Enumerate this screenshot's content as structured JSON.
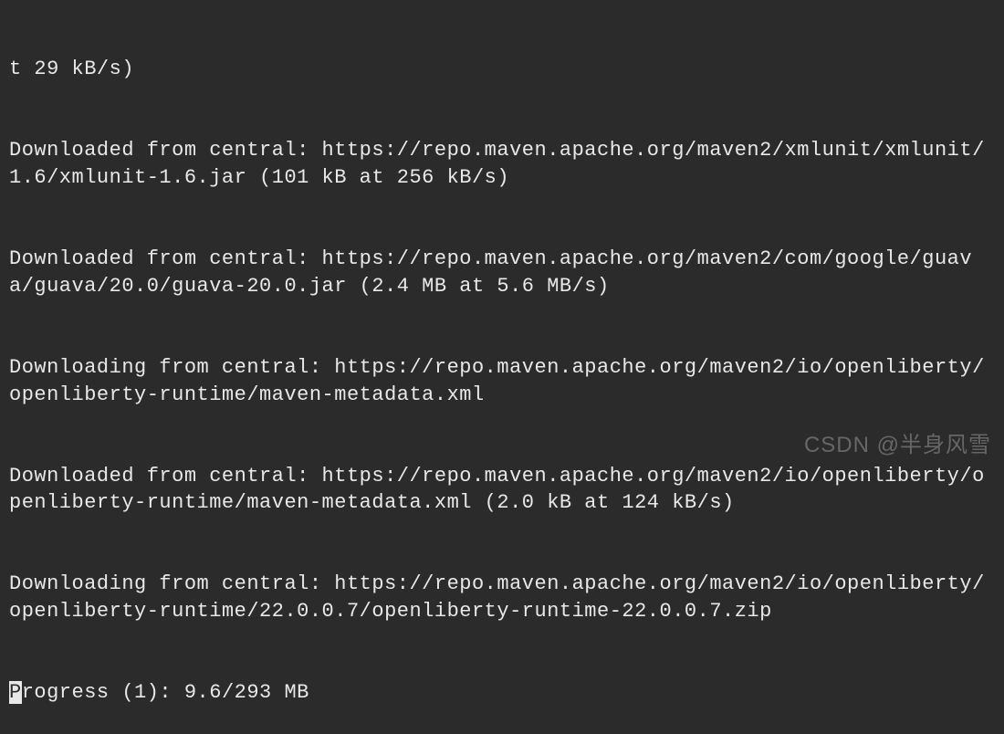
{
  "terminal": {
    "lines": [
      "t 29 kB/s)",
      "Downloaded from central: https://repo.maven.apache.org/maven2/xmlunit/xmlunit/1.6/xmlunit-1.6.jar (101 kB at 256 kB/s)",
      "Downloaded from central: https://repo.maven.apache.org/maven2/com/google/guava/guava/20.0/guava-20.0.jar (2.4 MB at 5.6 MB/s)",
      "Downloading from central: https://repo.maven.apache.org/maven2/io/openliberty/openliberty-runtime/maven-metadata.xml",
      "Downloaded from central: https://repo.maven.apache.org/maven2/io/openliberty/openliberty-runtime/maven-metadata.xml (2.0 kB at 124 kB/s)",
      "Downloading from central: https://repo.maven.apache.org/maven2/io/openliberty/openliberty-runtime/22.0.0.7/openliberty-runtime-22.0.0.7.zip"
    ],
    "progress_line_prefix": "P",
    "progress_line_rest": "rogress (1): 9.6/293 MB"
  },
  "watermark": "CSDN @半身风雪"
}
